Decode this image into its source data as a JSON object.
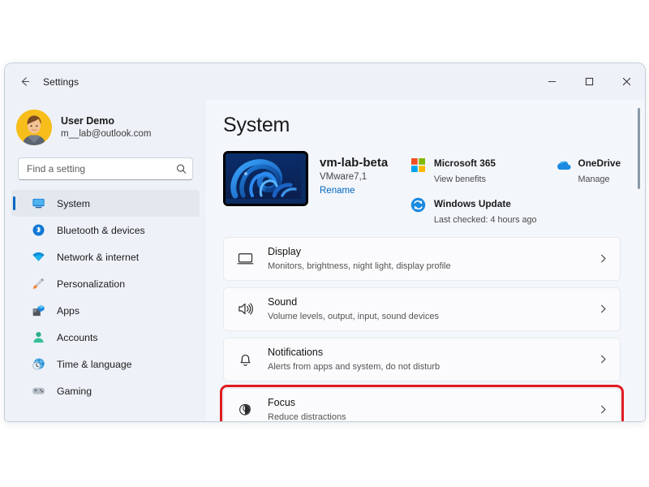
{
  "window": {
    "title": "Settings",
    "back_icon": "back-arrow-icon",
    "controls": {
      "minimize": "minimize-icon",
      "maximize": "maximize-icon",
      "close": "close-icon"
    }
  },
  "account": {
    "name": "User Demo",
    "email": "m__lab@outlook.com",
    "avatar_bg": "#f7bd1b"
  },
  "search": {
    "placeholder": "Find a setting",
    "value": "",
    "icon": "search-icon"
  },
  "sidebar": {
    "items": [
      {
        "label": "System",
        "icon": "monitor-icon",
        "selected": true
      },
      {
        "label": "Bluetooth & devices",
        "icon": "bluetooth-icon",
        "selected": false
      },
      {
        "label": "Network & internet",
        "icon": "wifi-icon",
        "selected": false
      },
      {
        "label": "Personalization",
        "icon": "paintbrush-icon",
        "selected": false
      },
      {
        "label": "Apps",
        "icon": "apps-icon",
        "selected": false
      },
      {
        "label": "Accounts",
        "icon": "person-icon",
        "selected": false
      },
      {
        "label": "Time & language",
        "icon": "clock-globe-icon",
        "selected": false
      },
      {
        "label": "Gaming",
        "icon": "gamepad-icon",
        "selected": false
      }
    ],
    "accent_color": "#0067c0",
    "background": "#eef2f8"
  },
  "main": {
    "page_title": "System",
    "device": {
      "name": "vm-lab-beta",
      "model": "VMware7,1",
      "rename_label": "Rename",
      "thumbnail": "windows11-bloom-wallpaper"
    },
    "tiles": [
      {
        "title": "Microsoft 365",
        "subtitle": "View benefits",
        "icon": "microsoft-logo-icon"
      },
      {
        "title": "OneDrive",
        "subtitle": "Manage",
        "icon": "onedrive-cloud-icon"
      },
      {
        "title": "Windows Update",
        "subtitle": "Last checked: 4 hours ago",
        "icon": "windows-update-icon"
      }
    ],
    "cards": [
      {
        "title": "Display",
        "subtitle": "Monitors, brightness, night light, display profile",
        "icon": "display-monitor-icon",
        "highlighted": false
      },
      {
        "title": "Sound",
        "subtitle": "Volume levels, output, input, sound devices",
        "icon": "speaker-icon",
        "highlighted": false
      },
      {
        "title": "Notifications",
        "subtitle": "Alerts from apps and system, do not disturb",
        "icon": "bell-icon",
        "highlighted": false
      },
      {
        "title": "Focus",
        "subtitle": "Reduce distractions",
        "icon": "focus-icon",
        "highlighted": true
      }
    ],
    "chevron_icon": "chevron-right-icon",
    "highlight_color": "#e01b20",
    "link_color": "#0067c0"
  }
}
